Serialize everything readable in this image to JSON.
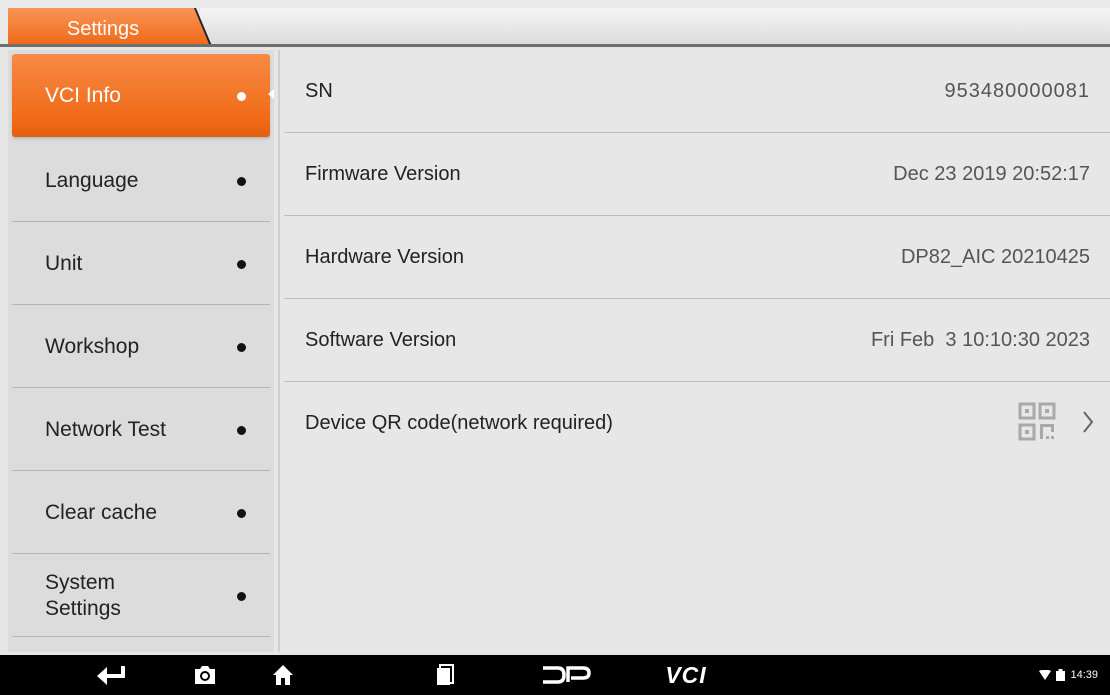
{
  "header": {
    "active_tab": "Settings"
  },
  "sidebar": {
    "items": [
      {
        "label": "VCI Info",
        "active": true
      },
      {
        "label": "Language",
        "active": false
      },
      {
        "label": "Unit",
        "active": false
      },
      {
        "label": "Workshop",
        "active": false
      },
      {
        "label": "Network Test",
        "active": false
      },
      {
        "label": "Clear cache",
        "active": false
      },
      {
        "label": "System Settings",
        "active": false
      }
    ]
  },
  "vci_info": {
    "rows": [
      {
        "label": "SN",
        "value": "953480000081"
      },
      {
        "label": "Firmware Version",
        "value": "Dec 23 2019 20:52:17"
      },
      {
        "label": "Hardware Version",
        "value": "DP82_AIC 20210425"
      },
      {
        "label": "Software Version",
        "value": "Fri Feb  3 10:10:30 2023"
      },
      {
        "label": "Device QR code(network required)",
        "value": ""
      }
    ]
  },
  "navbar": {
    "buttons": [
      "back-icon",
      "screenshot-icon",
      "home-icon",
      "recent-apps-icon",
      "dp-logo-icon",
      "vci-icon"
    ],
    "vci_label": "VCI",
    "status_time": "14:39"
  },
  "colors": {
    "accent": "#f26f1c",
    "background": "#e7e7e7",
    "sidebar": "#dcdcdc",
    "navbar": "#000000"
  }
}
